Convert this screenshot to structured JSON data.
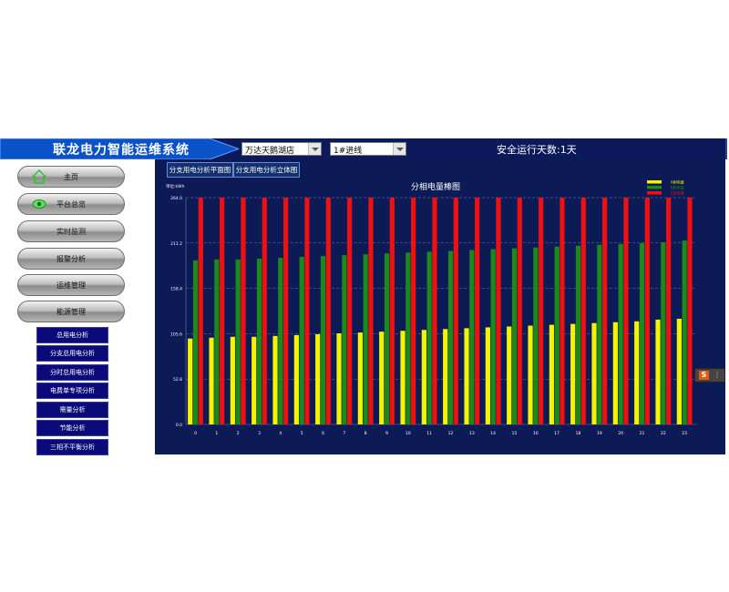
{
  "app": {
    "title": "联龙电力智能运维系统",
    "safe_days": "安全运行天数:1天"
  },
  "selectors": {
    "store": "万达天鹅湖店",
    "line": "1#进线"
  },
  "sidebar": {
    "items": [
      {
        "label": "主页",
        "icon": "home-icon"
      },
      {
        "label": "平台总览",
        "icon": "eye-icon"
      },
      {
        "label": "实时监测"
      },
      {
        "label": "报警分析"
      },
      {
        "label": "运维管理"
      },
      {
        "label": "能源管理"
      }
    ],
    "subitems": [
      "总用电分析",
      "分支总用电分析",
      "分时总用电分析",
      "电费单专项分析",
      "需量分析",
      "节能分析",
      "三相不平衡分析"
    ]
  },
  "tabs": [
    "分支用电分析平面图",
    "分支用电分析立体图"
  ],
  "colors": {
    "yellow": "#f4f400",
    "green": "#1a8a1a",
    "red": "#ee1111",
    "panel": "#0c1a56"
  },
  "chart_data": {
    "type": "bar",
    "title": "分相电量棒图",
    "unit_label": "单位:kWh",
    "ylim": [
      0,
      264.0
    ],
    "yticks": [
      "0.0",
      "52.8",
      "105.6",
      "158.4",
      "211.2",
      "264.0"
    ],
    "categories": [
      "0",
      "1",
      "2",
      "3",
      "4",
      "5",
      "6",
      "7",
      "8",
      "9",
      "10",
      "11",
      "12",
      "13",
      "14",
      "15",
      "16",
      "17",
      "18",
      "19",
      "20",
      "21",
      "22",
      "23"
    ],
    "series": [
      {
        "name": "A相电量",
        "color": "#f4f400",
        "values": [
          100,
          101,
          102,
          102,
          103,
          104,
          105,
          106,
          107,
          108,
          109,
          110,
          111,
          112,
          113,
          114,
          115,
          116,
          117,
          118,
          119,
          120,
          122,
          123
        ]
      },
      {
        "name": "B相电量",
        "color": "#1a8a1a",
        "values": [
          191,
          192,
          192,
          193,
          194,
          195,
          196,
          197,
          198,
          199,
          200,
          201,
          202,
          203,
          204,
          205,
          206,
          207,
          208,
          209,
          210,
          211,
          212,
          214
        ]
      },
      {
        "name": "C相电量",
        "color": "#ee1111",
        "values": [
          264,
          264,
          264,
          264,
          264,
          264,
          264,
          264,
          264,
          264,
          264,
          264,
          264,
          264,
          264,
          264,
          264,
          264,
          264,
          264,
          264,
          264,
          264,
          264
        ]
      }
    ],
    "grid": true,
    "legend_position": "top-right"
  }
}
